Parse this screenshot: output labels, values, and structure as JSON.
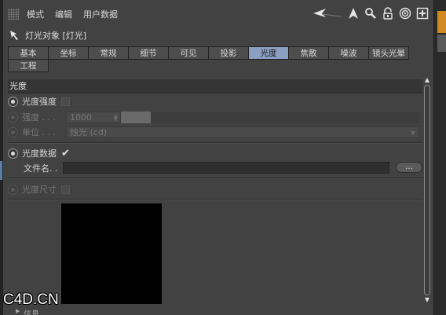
{
  "menubar": {
    "items": [
      "模式",
      "编辑",
      "用户数据"
    ]
  },
  "toolbar": {
    "icons": [
      "back-arrow-icon",
      "cursor-up-icon",
      "search-icon",
      "lock-icon",
      "target-icon",
      "add-icon"
    ]
  },
  "object": {
    "title": "灯光对象 [灯光]"
  },
  "tabs": {
    "row1": [
      "基本",
      "坐标",
      "常规",
      "细节",
      "可见",
      "投影",
      "光度",
      "焦散",
      "噪波",
      "镜头光晕"
    ],
    "row2": [
      "工程"
    ],
    "active": "光度"
  },
  "section": {
    "title": "光度"
  },
  "photometric": {
    "intensity_label": "光度强度",
    "strength_label": "强度 . . .",
    "strength_value": "1000",
    "unit_label": "单位 . . .",
    "unit_value": "烛光 (cd)",
    "data_label": "光度数据",
    "data_checked": "✔",
    "filename_label": "文件名. .",
    "filename_value": "",
    "browse_label": "...",
    "size_label": "光度尺寸"
  },
  "footer": {
    "info_label": "信息"
  },
  "watermark": {
    "text": "C4D.CN"
  },
  "colors": {
    "active_tab": "#8a9fc2",
    "panel": "#424242",
    "accent_right": "#d08a21"
  }
}
